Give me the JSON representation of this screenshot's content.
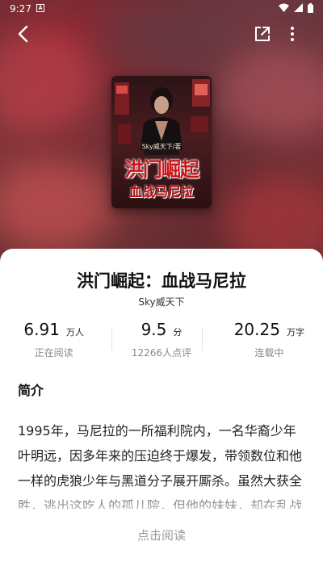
{
  "status_bar": {
    "time": "9:27"
  },
  "book": {
    "title": "洪门崛起：血战马尼拉",
    "author": "Sky威天下",
    "cover": {
      "author_line": "Sky威天下/著",
      "title_line1": "洪门崛起",
      "title_line2": "血战马尼拉"
    }
  },
  "stats": [
    {
      "value": "6.91",
      "unit": "万人",
      "label": "正在阅读"
    },
    {
      "value": "9.5",
      "unit": "分",
      "label": "12266人点评"
    },
    {
      "value": "20.25",
      "unit": "万字",
      "label": "连载中"
    }
  ],
  "intro": {
    "heading": "简介",
    "text": "1995年，马尼拉的一所福利院内，一名华裔少年叶明远，因多年来的压迫终于爆发，带领数位和他一样的虎狼少年与黑道分子展开厮杀。虽然大获全胜，逃出这吃人的孤儿院，但他的妹妹，却在乱战中，被黑"
  },
  "action": {
    "read_label": "点击阅读"
  },
  "icons": [
    "back-arrow-icon",
    "share-icon",
    "more-vertical-icon",
    "wifi-icon",
    "signal-icon",
    "battery-icon",
    "notification-icon"
  ],
  "colors": {
    "cover_title": "#c8141b",
    "muted_text": "#888888"
  }
}
